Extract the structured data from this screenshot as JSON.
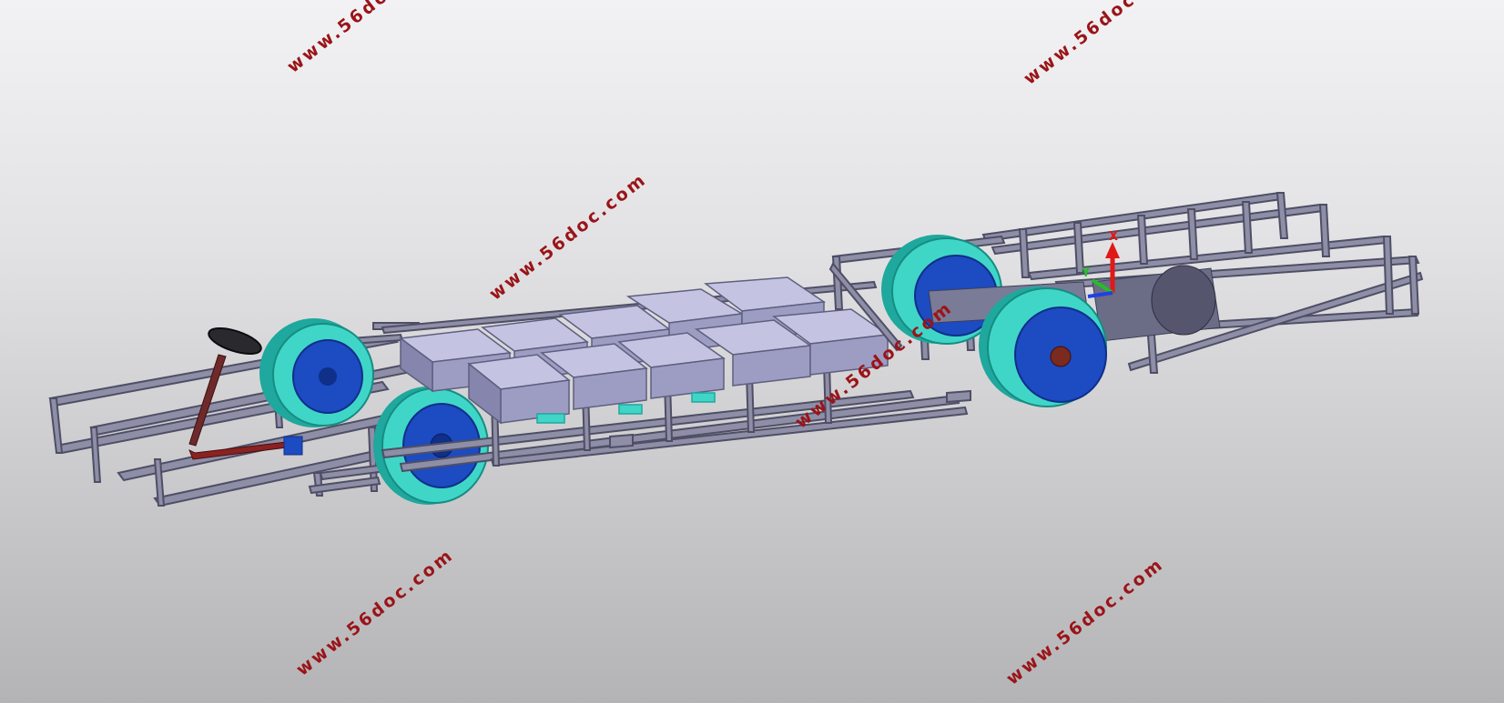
{
  "watermark": {
    "text": "www.56doc.com",
    "color": "#9a1418"
  },
  "triad": {
    "x_label": "X",
    "y_label": "Y"
  },
  "model": {
    "colors": {
      "frame": "#8e8fa6",
      "frame_dark": "#4e4f66",
      "battery": "#b3b3d6",
      "battery_dark": "#6f708f",
      "tire": "#3fd6c8",
      "tire_dark": "#1fa89d",
      "rim": "#1c4bc2",
      "rim_dark": "#0f2f88",
      "steering": "#2a2a2e",
      "column": "#8a2222"
    },
    "icons": [
      "steering-wheel-icon",
      "axis-triad-icon"
    ]
  }
}
